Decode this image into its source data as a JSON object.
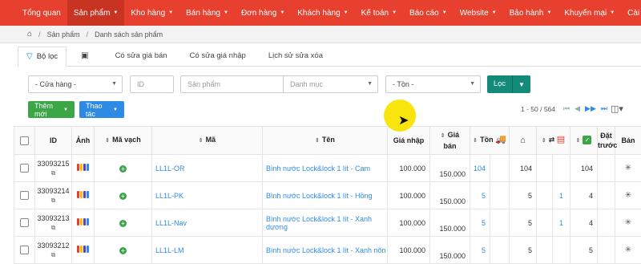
{
  "nav": {
    "items": [
      {
        "label": "Tổng quan",
        "caret": false,
        "active": false
      },
      {
        "label": "Sản phẩm",
        "caret": true,
        "active": true
      },
      {
        "label": "Kho hàng",
        "caret": true,
        "active": false
      },
      {
        "label": "Bán hàng",
        "caret": true,
        "active": false
      },
      {
        "label": "Đơn hàng",
        "caret": true,
        "active": false
      },
      {
        "label": "Khách hàng",
        "caret": true,
        "active": false
      },
      {
        "label": "Kế toán",
        "caret": true,
        "active": false
      },
      {
        "label": "Báo cáo",
        "caret": true,
        "active": false
      },
      {
        "label": "Website",
        "caret": true,
        "active": false
      },
      {
        "label": "Bảo hành",
        "caret": true,
        "active": false
      },
      {
        "label": "Khuyến mại",
        "caret": true,
        "active": false
      },
      {
        "label": "Cài đặt",
        "caret": true,
        "active": false
      }
    ],
    "color": "#e8402e"
  },
  "breadcrumb": {
    "home_icon": "home-icon",
    "item1": "Sản phẩm",
    "item2": "Danh sách sản phẩm"
  },
  "tabs": {
    "filter": "Bộ lọc",
    "t1": "Có sửa giá bán",
    "t2": "Có sửa giá nhập",
    "t3": "Lịch sử sửa xóa"
  },
  "filters": {
    "store": "- Cửa hàng -",
    "id_placeholder": "ID",
    "product_placeholder": "Sản phẩm",
    "category_placeholder": "Danh mục",
    "stock": "- Tồn -",
    "submit": "Lọc"
  },
  "actions": {
    "add": "Thêm mới",
    "ops": "Thao tác"
  },
  "pager": {
    "range": "1 - 50 / 564"
  },
  "table": {
    "headers": {
      "id": "ID",
      "image": "Ảnh",
      "barcode": "Mã vạch",
      "code": "Mã",
      "name": "Tên",
      "import_price": "Giá nhập",
      "sale_price_1": "Giá",
      "sale_price_2": "bán",
      "stock": "Tồn",
      "preorder_1": "Đặt",
      "preorder_2": "trước",
      "sell": "Bán"
    },
    "rows": [
      {
        "id": "33093215",
        "code": "LL1L-OR",
        "name": "Bình nước Lock&lock 1 lít - Cam",
        "import_price": "100.000",
        "sale_price": "150.000",
        "stock": "104",
        "warehouse": "104",
        "transfer": "",
        "checked": "104"
      },
      {
        "id": "33093214",
        "code": "LL1L-PK",
        "name": "Bình nước Lock&lock 1 lít - Hồng",
        "import_price": "100.000",
        "sale_price": "150.000",
        "stock": "5",
        "warehouse": "5",
        "transfer": "1",
        "checked": "4"
      },
      {
        "id": "33093213",
        "code": "LL1L-Nav",
        "name": "Bình nước Lock&lock 1 lít - Xanh dương",
        "import_price": "100.000",
        "sale_price": "150.000",
        "stock": "5",
        "warehouse": "5",
        "transfer": "1",
        "checked": "4"
      },
      {
        "id": "33093212",
        "code": "LL1L-LM",
        "name": "Bình nước Lock&lock 1 lít - Xanh nõn",
        "import_price": "100.000",
        "sale_price": "150.000",
        "stock": "5",
        "warehouse": "5",
        "transfer": "",
        "checked": "5"
      }
    ]
  }
}
